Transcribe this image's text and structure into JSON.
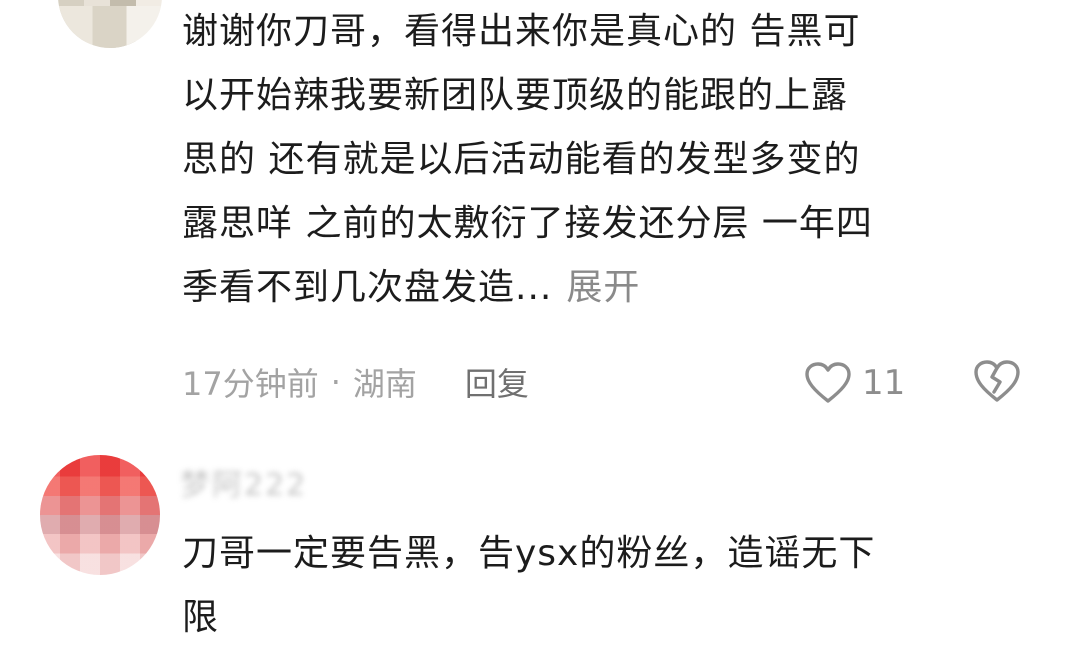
{
  "comments": [
    {
      "text_lines": [
        "谢谢你刀哥，看得出来你是真心的 告黑可",
        "以开始辣我要新团队要顶级的能跟的上露",
        "思的 还有就是以后活动能看的发型多变的",
        "露思咩 之前的太敷衍了接发还分层 一年四",
        "季看不到几次盘发造..."
      ],
      "expand_label": "展开",
      "time": "17分钟前",
      "dot": "·",
      "location": "湖南",
      "reply_label": "回复",
      "like_count": "11",
      "icons": {
        "like": "heart-icon",
        "dislike": "broken-heart-icon"
      }
    },
    {
      "username": "梦阿222",
      "text_lines": [
        "刀哥一定要告黑，告ysx的粉丝，造谣无下",
        "限"
      ]
    }
  ],
  "colors": {
    "text": "#1c1c1c",
    "meta": "#a3a3a3",
    "reply": "#707070",
    "icon": "#8d8d8d",
    "background": "#ffffff"
  }
}
